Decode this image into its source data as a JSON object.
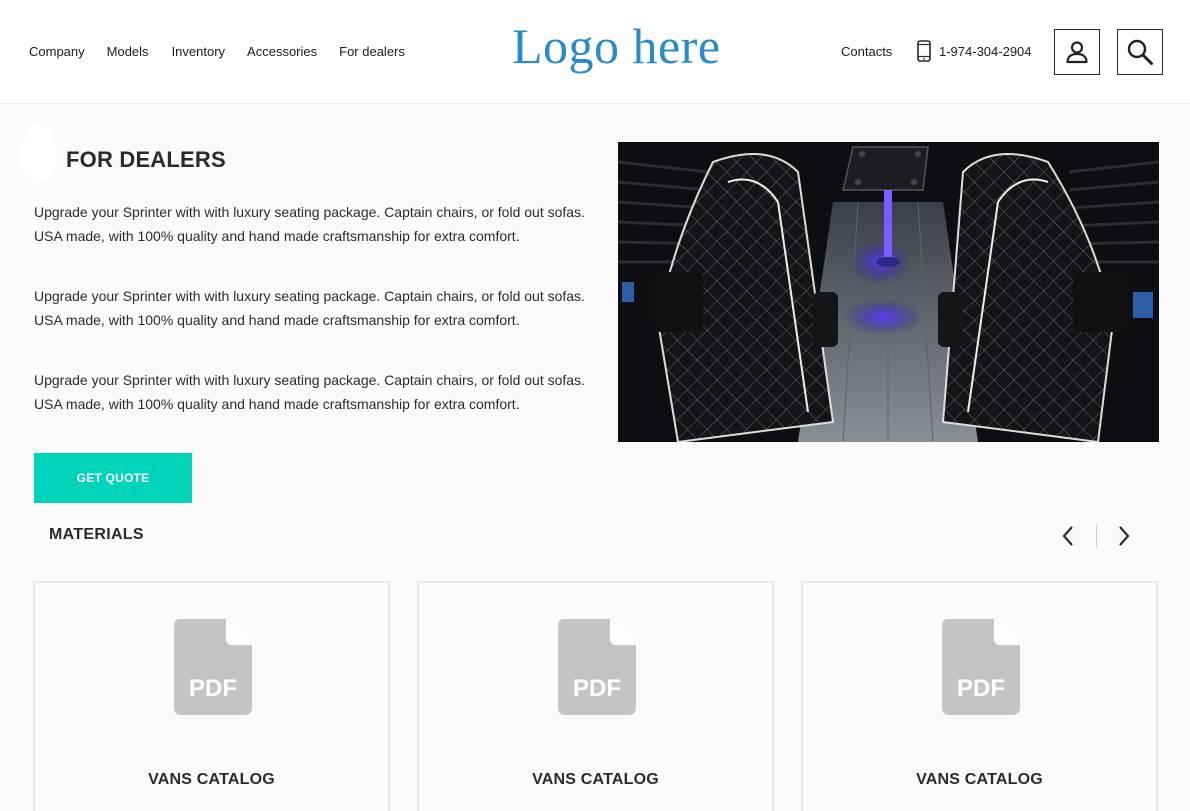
{
  "header": {
    "nav": [
      "Company",
      "Models",
      "Inventory",
      "Accessories",
      "For dealers"
    ],
    "logo": "Logo here",
    "contacts": "Contacts",
    "phone": "1-974-304-2904",
    "icons": {
      "phone": "phone-icon",
      "user": "user-icon",
      "search": "search-icon"
    }
  },
  "hero": {
    "title": "FOR DEALERS",
    "paragraphs": [
      "Upgrade your Sprinter with with luxury seating package. Captain chairs, or fold out sofas. USA made, with 100% quality and hand made craftsmanship for extra comfort.",
      "Upgrade your Sprinter with with luxury seating package. Captain chairs, or fold out sofas. USA made, with 100% quality and hand made craftsmanship for extra comfort.",
      "Upgrade your Sprinter with with luxury seating package. Captain chairs, or fold out sofas. USA made, with 100% quality and hand made craftsmanship for extra comfort."
    ],
    "button": "GET QUOTE"
  },
  "materials": {
    "title": "MATERIALS",
    "cards": [
      {
        "badge": "PDF",
        "title": "VANS CATALOG"
      },
      {
        "badge": "PDF",
        "title": "VANS CATALOG"
      },
      {
        "badge": "PDF",
        "title": "VANS CATALOG"
      }
    ],
    "icons": {
      "prev": "chevron-left-icon",
      "next": "chevron-right-icon",
      "file": "pdf-file-icon"
    }
  },
  "colors": {
    "accent": "#00d4b8",
    "logo": "#2a8bc9",
    "pdf_icon": "#c4c4c4"
  }
}
